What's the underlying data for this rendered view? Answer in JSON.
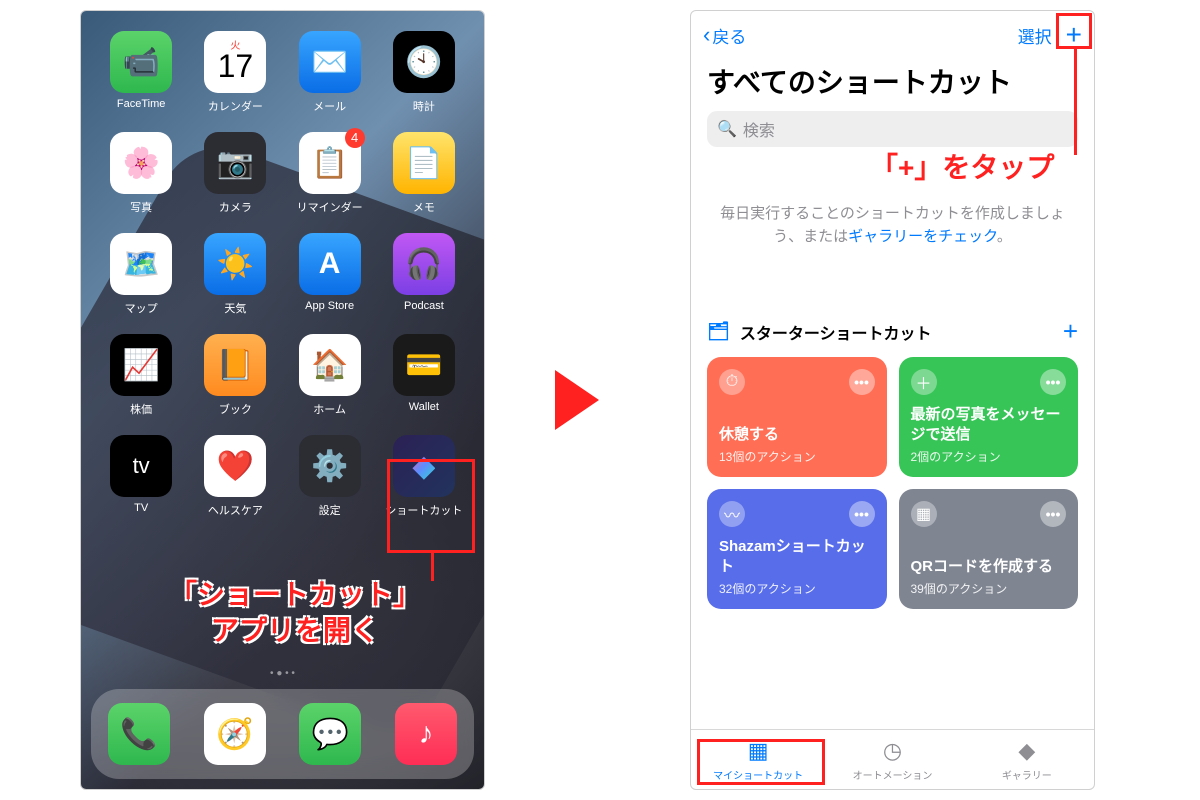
{
  "callouts": {
    "open_shortcuts": "「ショートカット」\nアプリを開く",
    "tap_plus": "「+」をタップ"
  },
  "home": {
    "apps": [
      {
        "label": "FaceTime",
        "icon": "📹",
        "bg": "bg-green"
      },
      {
        "label": "カレンダー",
        "icon": "17",
        "bg": "bg-white",
        "day": "火"
      },
      {
        "label": "メール",
        "icon": "✉️",
        "bg": "bg-blue"
      },
      {
        "label": "時計",
        "icon": "🕙",
        "bg": "bg-black"
      },
      {
        "label": "写真",
        "icon": "🌸",
        "bg": "bg-photos"
      },
      {
        "label": "カメラ",
        "icon": "📷",
        "bg": "bg-dark"
      },
      {
        "label": "リマインダー",
        "icon": "📋",
        "bg": "bg-reminders",
        "badge": "4"
      },
      {
        "label": "メモ",
        "icon": "📄",
        "bg": "bg-yellow"
      },
      {
        "label": "マップ",
        "icon": "🗺️",
        "bg": "bg-white"
      },
      {
        "label": "天気",
        "icon": "☀️",
        "bg": "bg-blue"
      },
      {
        "label": "App Store",
        "icon": "A",
        "bg": "bg-blue"
      },
      {
        "label": "Podcast",
        "icon": "🎧",
        "bg": "bg-purple"
      },
      {
        "label": "株価",
        "icon": "📈",
        "bg": "bg-black"
      },
      {
        "label": "ブック",
        "icon": "📙",
        "bg": "bg-orange"
      },
      {
        "label": "ホーム",
        "icon": "🏠",
        "bg": "bg-white"
      },
      {
        "label": "Wallet",
        "icon": "💳",
        "bg": "bg-wallet"
      },
      {
        "label": "TV",
        "icon": "tv",
        "bg": "bg-black"
      },
      {
        "label": "ヘルスケア",
        "icon": "❤️",
        "bg": "bg-white"
      },
      {
        "label": "設定",
        "icon": "⚙️",
        "bg": "bg-dark"
      },
      {
        "label": "ショートカット",
        "icon": "◆",
        "bg": "bg-sc"
      }
    ],
    "dock": [
      {
        "name": "phone",
        "icon": "📞",
        "bg": "bg-green"
      },
      {
        "name": "safari",
        "icon": "🧭",
        "bg": "bg-safari"
      },
      {
        "name": "messages",
        "icon": "💬",
        "bg": "bg-msg"
      },
      {
        "name": "music",
        "icon": "♪",
        "bg": "bg-music"
      }
    ]
  },
  "shortcuts": {
    "nav": {
      "back": "戻る",
      "select": "選択",
      "plus": "+"
    },
    "title": "すべてのショートカット",
    "search_placeholder": "検索",
    "hint_pre": "毎日実行することのショートカットを作成しましょう、または",
    "hint_link": "ギャラリーをチェック",
    "hint_post": "。",
    "section": "スターターショートカット",
    "cards": [
      {
        "title": "休憩する",
        "sub": "13個のアクション",
        "color": "#ff6e55",
        "icon": "⏱"
      },
      {
        "title": "最新の写真をメッセージで送信",
        "sub": "2個のアクション",
        "color": "#38c558",
        "icon": "＋"
      },
      {
        "title": "Shazamショートカット",
        "sub": "32個のアクション",
        "color": "#586dea",
        "icon": "〰"
      },
      {
        "title": "QRコードを作成する",
        "sub": "39個のアクション",
        "color": "#7f8591",
        "icon": "▦"
      }
    ],
    "tabs": [
      {
        "label": "マイショートカット",
        "icon": "▦",
        "active": true
      },
      {
        "label": "オートメーション",
        "icon": "◷",
        "active": false
      },
      {
        "label": "ギャラリー",
        "icon": "◆",
        "active": false
      }
    ]
  }
}
